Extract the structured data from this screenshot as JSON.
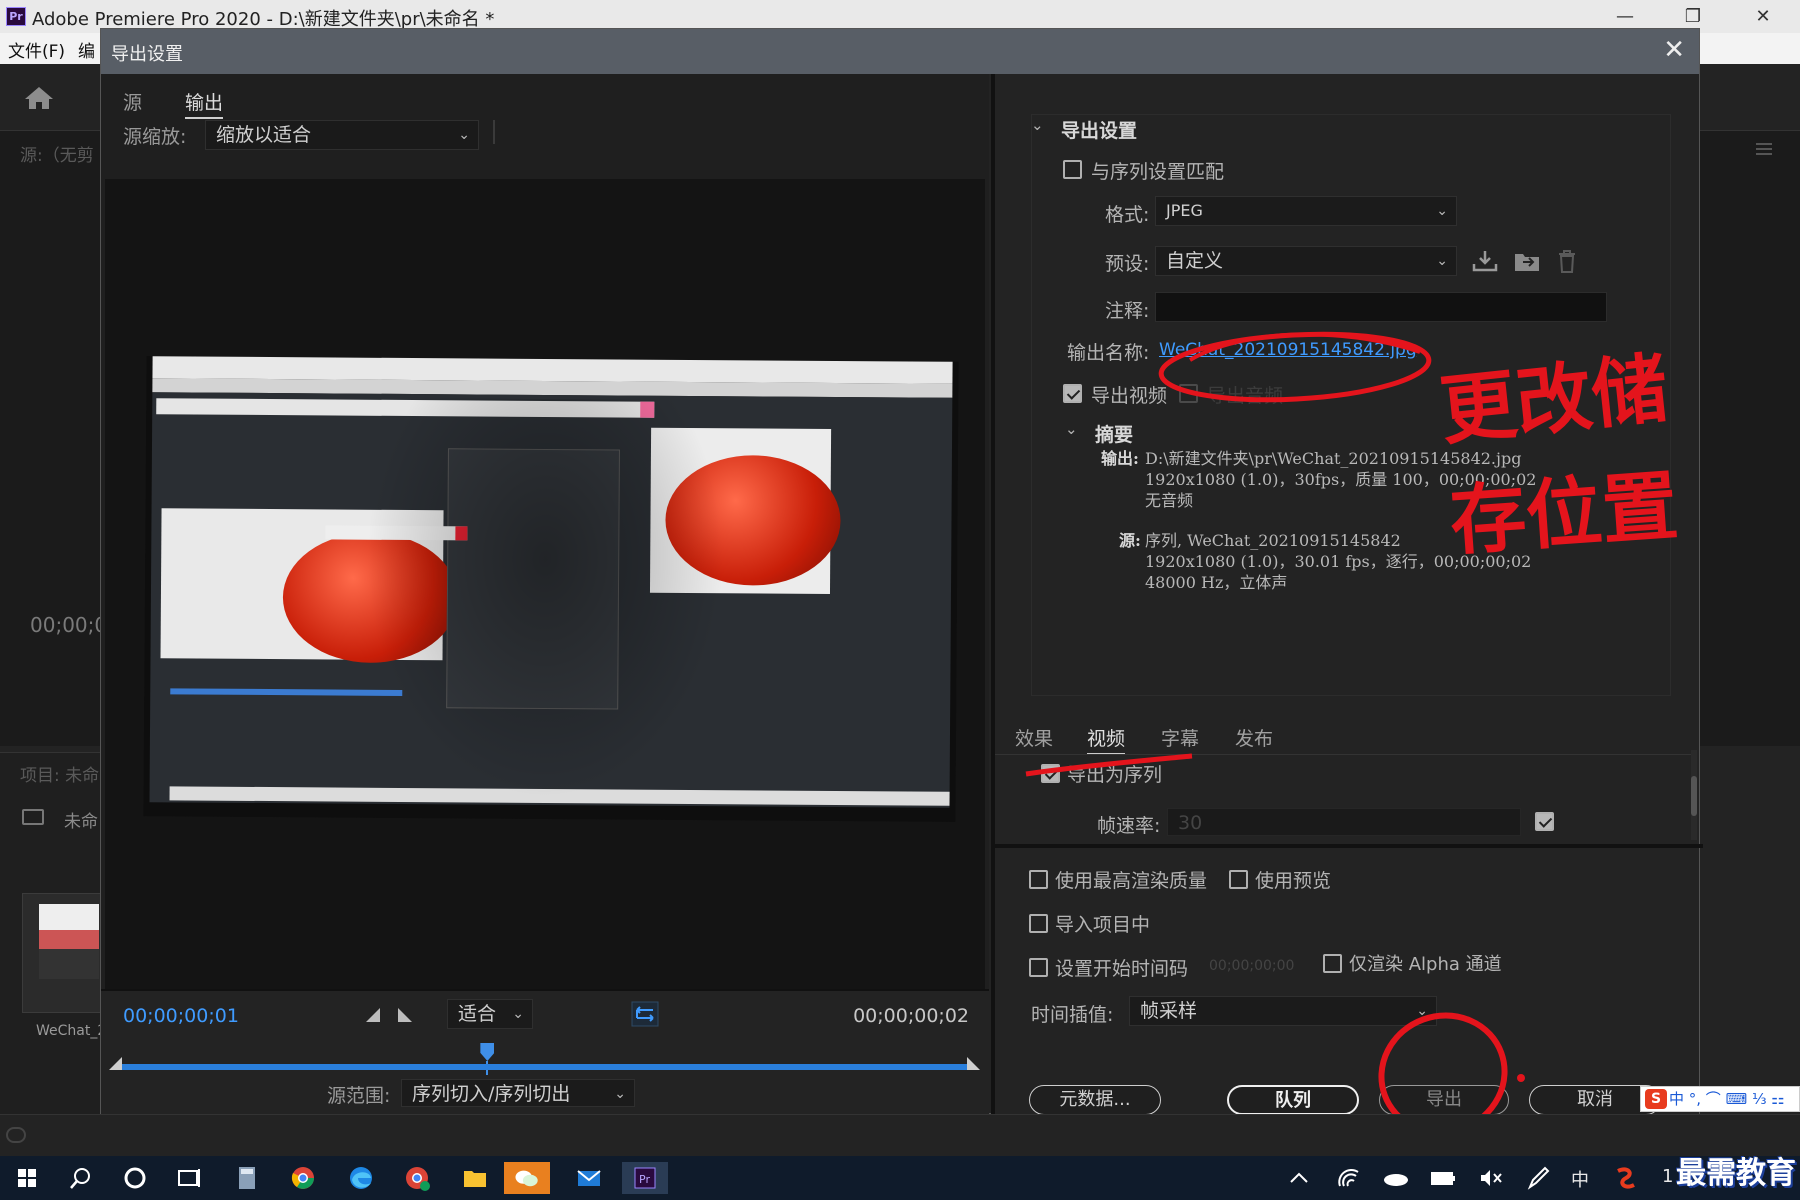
{
  "app": {
    "title": "Adobe Premiere Pro 2020 - D:\\新建文件夹\\pr\\未命名 *",
    "logo": "Pr",
    "menu": [
      "文件(F)",
      "编"
    ],
    "window_buttons": [
      "—",
      "❐",
      "✕"
    ],
    "left_panel_source_label": "源:（无剪",
    "left_panel_timecode": "00;00;0",
    "project_label": "项目: 未命",
    "project_item": "未命",
    "thumb_name": "WeChat_2"
  },
  "dialog": {
    "title": "导出设置",
    "close": "✕",
    "tabs": [
      "源",
      "输出"
    ],
    "active_tab": "输出",
    "source_scale_label": "源缩放:",
    "source_scale_value": "缩放以适合",
    "transport": {
      "current_timecode": "00;00;00;01",
      "end_timecode": "00;00;00;02",
      "fit_value": "适合",
      "source_range_label": "源范围:",
      "source_range_value": "序列切入/序列切出",
      "playhead_fraction": 0.43
    },
    "export_settings": {
      "header": "导出设置",
      "match_sequence_label": "与序列设置匹配",
      "match_sequence_checked": false,
      "format_label": "格式:",
      "format_value": "JPEG",
      "preset_label": "预设:",
      "preset_value": "自定义",
      "comment_label": "注释:",
      "comment_value": "",
      "output_name_label": "输出名称:",
      "output_name_value": "WeChat_20210915145842.jpg",
      "export_video_label": "导出视频",
      "export_video_checked": true,
      "export_audio_label": "导出音频",
      "export_audio_checked": false
    },
    "summary": {
      "header": "摘要",
      "output_label": "输出:",
      "output_lines": [
        "D:\\新建文件夹\\pr\\WeChat_20210915145842.jpg",
        "1920x1080 (1.0)，30fps，质量 100，00;00;00;02",
        "无音频"
      ],
      "source_label": "源:",
      "source_lines": [
        "序列, WeChat_20210915145842",
        "1920x1080 (1.0)，30.01 fps，逐行，00;00;00;02",
        "48000 Hz，立体声"
      ]
    },
    "subtabs": [
      "效果",
      "视频",
      "字幕",
      "发布"
    ],
    "active_subtab": "视频",
    "export_as_sequence_label": "导出为序列",
    "export_as_sequence_checked": true,
    "frame_rate_label": "帧速率:",
    "frame_rate_value": "30",
    "options": {
      "max_render_quality": "使用最高渲染质量",
      "use_previews": "使用预览",
      "import_into_project": "导入项目中",
      "set_start_timecode": "设置开始时间码",
      "start_timecode_value": "00;00;00;00",
      "render_alpha_only": "仅渲染 Alpha 通道",
      "time_interpolation_label": "时间插值:",
      "time_interpolation_value": "帧采样"
    },
    "buttons": {
      "metadata": "元数据...",
      "queue": "队列",
      "export": "导出",
      "cancel": "取消"
    }
  },
  "annotations": {
    "line1": "更改储",
    "line2": "存位置",
    "color": "#e4141c"
  },
  "taskbar": {
    "tray_ime": "中",
    "clock_partial": "1",
    "ime_bar": "中 °, ⌒ ⌨ ⅓ ⚏",
    "ime_logo": "S",
    "watermark": "最需教育"
  }
}
